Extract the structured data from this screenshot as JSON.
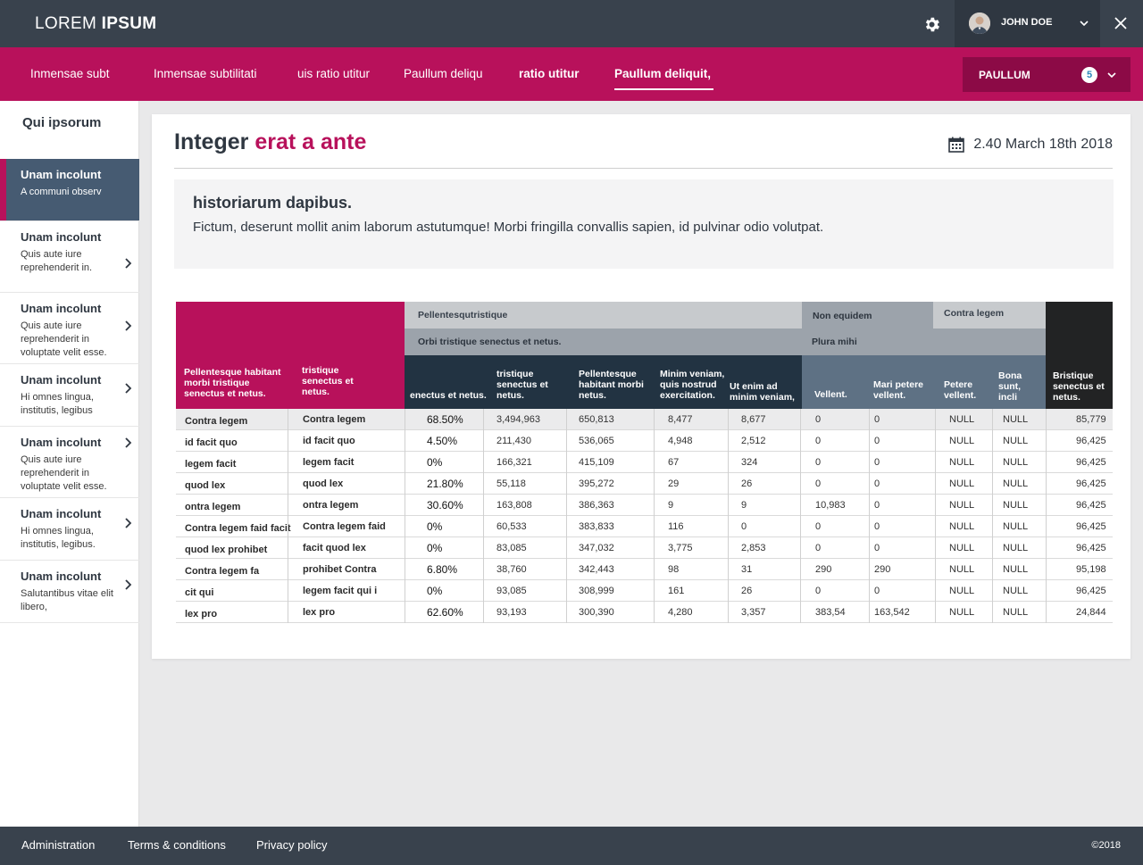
{
  "app": {
    "logo_light": "LOREM",
    "logo_bold": "IPSUM",
    "user_name": "JOHN DOE"
  },
  "nav": {
    "items": [
      {
        "label": "Inmensae subt"
      },
      {
        "label": "Inmensae subtilitati"
      },
      {
        "label": "uis ratio utitur"
      },
      {
        "label": "Paullum deliqu"
      },
      {
        "label": "ratio utitur"
      },
      {
        "label": "Paullum deliquit,"
      }
    ],
    "active_index": 5,
    "select_label": "PAULLUM",
    "select_count": "5"
  },
  "sidebar": {
    "title": "Qui ipsorum",
    "items": [
      {
        "title": "Unam incolunt",
        "desc": "A communi observ"
      },
      {
        "title": "Unam incolunt",
        "desc": "Quis aute iure reprehenderit in."
      },
      {
        "title": "Unam incolunt",
        "desc": "Quis aute iure reprehenderit in voluptate velit esse."
      },
      {
        "title": "Unam incolunt",
        "desc": "Hi omnes lingua, institutis, legibus"
      },
      {
        "title": "Unam incolunt",
        "desc": "Quis aute iure reprehenderit in voluptate velit esse."
      },
      {
        "title": "Unam incolunt",
        "desc": "Hi omnes lingua, institutis, legibus."
      },
      {
        "title": "Unam incolunt",
        "desc": "Salutantibus vitae elit libero,"
      }
    ]
  },
  "main": {
    "title_plain": "Integer",
    "title_accent": "erat a ante",
    "date": "2.40 March 18th 2018",
    "info_heading": "historiarum dapibus.",
    "info_text": "Fictum, deserunt mollit anim laborum astutumque! Morbi fringilla convallis sapien, id pulvinar odio volutpat."
  },
  "table": {
    "group_headers": {
      "g1": "Pellentesqutristique",
      "g1_sub": "Orbi tristique senectus et netus.",
      "g2": "Non equidem",
      "g3": "Contra legem",
      "g23_sub": "Plura mihi"
    },
    "columns": [
      "Pellentesque habitant morbi tristique senectus et netus.",
      "tristique senectus et netus.",
      "enectus et netus.",
      "tristique senectus et netus.",
      "Pellentesque habitant morbi netus.",
      "Minim veniam, quis nostrud exercitation.",
      "Ut enim ad minim veniam,",
      "Vellent.",
      "Mari petere vellent.",
      "Petere vellent.",
      "Bona sunt, incli",
      "Bristique senectus et netus."
    ],
    "rows": [
      [
        "Contra legem",
        "Contra legem",
        "68.50%",
        "3,494,963",
        "650,813",
        "8,477",
        "8,677",
        "0",
        "0",
        "NULL",
        "NULL",
        "85,779"
      ],
      [
        "id facit quo",
        "id facit quo",
        "4.50%",
        "211,430",
        "536,065",
        "4,948",
        "2,512",
        "0",
        "0",
        "NULL",
        "NULL",
        "96,425"
      ],
      [
        "legem facit",
        "legem facit",
        "0%",
        "166,321",
        "415,109",
        "67",
        "324",
        "0",
        "0",
        "NULL",
        "NULL",
        "96,425"
      ],
      [
        "quod lex",
        "quod lex",
        "21.80%",
        "55,118",
        "395,272",
        "29",
        "26",
        "0",
        "0",
        "NULL",
        "NULL",
        "96,425"
      ],
      [
        "ontra legem",
        "ontra legem",
        "30.60%",
        "163,808",
        "386,363",
        "9",
        "9",
        "10,983",
        "0",
        "NULL",
        "NULL",
        "96,425"
      ],
      [
        "Contra legem faid facit",
        "Contra legem faid",
        "0%",
        "60,533",
        "383,833",
        "116",
        "0",
        "0",
        "0",
        "NULL",
        "NULL",
        "96,425"
      ],
      [
        "quod lex prohibet",
        "facit quod lex",
        "0%",
        "83,085",
        "347,032",
        "3,775",
        "2,853",
        "0",
        "0",
        "NULL",
        "NULL",
        "96,425"
      ],
      [
        "Contra legem fa",
        "prohibet  Contra",
        "6.80%",
        "38,760",
        "342,443",
        "98",
        "31",
        "290",
        "290",
        "NULL",
        "NULL",
        "95,198"
      ],
      [
        "cit qui",
        "legem facit qui i",
        "0%",
        "93,085",
        "308,999",
        "161",
        "26",
        "0",
        "0",
        "NULL",
        "NULL",
        "96,425"
      ],
      [
        "lex pro",
        "lex pro",
        "62.60%",
        "93,193",
        "300,390",
        "4,280",
        "3,357",
        "383,54",
        "163,542",
        "NULL",
        "NULL",
        "24,844"
      ]
    ]
  },
  "footer": {
    "links": [
      "Administration",
      "Terms & conditions",
      "Privacy policy"
    ],
    "copyright": "©2018"
  },
  "colors": {
    "brand": "#b8115b",
    "topbar": "#39424d",
    "sidebar_active": "#465b72"
  },
  "icons": {
    "settings": "gear-icon",
    "user_menu": "chevron-down-icon",
    "close": "close-icon",
    "calendar": "calendar-icon",
    "sidebar_arrow": "chevron-right-icon"
  }
}
